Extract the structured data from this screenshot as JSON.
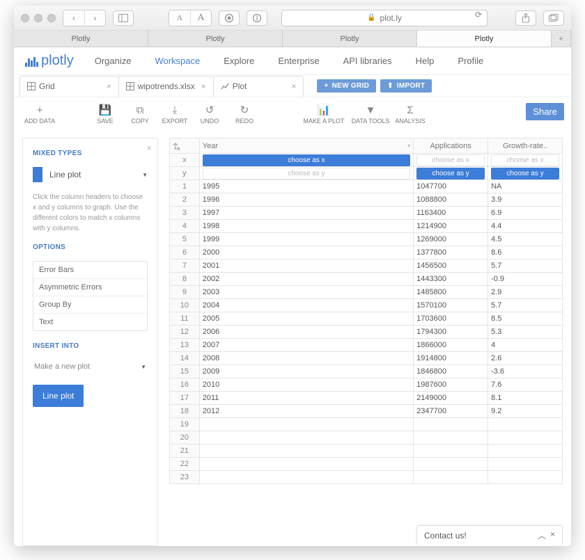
{
  "browser": {
    "url_host": "plot.ly",
    "tabs": [
      "Plotly",
      "Plotly",
      "Plotly",
      "Plotly"
    ],
    "active_tab_index": 3
  },
  "plotly_nav": {
    "brand": "plotly",
    "items": [
      "Organize",
      "Workspace",
      "Explore",
      "Enterprise",
      "API libraries",
      "Help",
      "Profile"
    ],
    "active_index": 1
  },
  "worksheet_tabs": {
    "grid_label": "Grid",
    "file_label": "wipotrends.xlsx",
    "plot_label": "Plot",
    "new_grid_btn": "NEW GRID",
    "import_btn": "IMPORT"
  },
  "toolbar": {
    "add_data": "ADD DATA",
    "save": "SAVE",
    "copy": "COPY",
    "export": "EXPORT",
    "undo": "UNDO",
    "redo": "REDO",
    "make_plot": "MAKE A PLOT",
    "data_tools": "DATA TOOLS",
    "analysis": "ANALYSIS",
    "share": "Share"
  },
  "left_panel": {
    "title": "MIXED TYPES",
    "chip_label": "Line plot",
    "help": "Click the column headers to choose x and y columns to graph. Use the different colors to match x columns with y columns.",
    "options_title": "OPTIONS",
    "options": [
      "Error Bars",
      "Asymmetric Errors",
      "Group By",
      "Text"
    ],
    "insert_title": "INSERT INTO",
    "insert_value": "Make a new plot",
    "primary_btn": "Line plot"
  },
  "grid": {
    "axis_labels": {
      "x": "x",
      "y": "y"
    },
    "columns": [
      "Year",
      "Applications",
      "Growth-rate.."
    ],
    "choose_x": "choose as x",
    "choose_y": "choose as y",
    "rows": [
      {
        "n": 1,
        "Year": "1995",
        "Applications": "1047700",
        "Growth": "NA"
      },
      {
        "n": 2,
        "Year": "1996",
        "Applications": "1088800",
        "Growth": "3.9"
      },
      {
        "n": 3,
        "Year": "1997",
        "Applications": "1163400",
        "Growth": "6.9"
      },
      {
        "n": 4,
        "Year": "1998",
        "Applications": "1214900",
        "Growth": "4.4"
      },
      {
        "n": 5,
        "Year": "1999",
        "Applications": "1269000",
        "Growth": "4.5"
      },
      {
        "n": 6,
        "Year": "2000",
        "Applications": "1377800",
        "Growth": "8.6"
      },
      {
        "n": 7,
        "Year": "2001",
        "Applications": "1456500",
        "Growth": "5.7"
      },
      {
        "n": 8,
        "Year": "2002",
        "Applications": "1443300",
        "Growth": "-0.9"
      },
      {
        "n": 9,
        "Year": "2003",
        "Applications": "1485800",
        "Growth": "2.9"
      },
      {
        "n": 10,
        "Year": "2004",
        "Applications": "1570100",
        "Growth": "5.7"
      },
      {
        "n": 11,
        "Year": "2005",
        "Applications": "1703600",
        "Growth": "8.5"
      },
      {
        "n": 12,
        "Year": "2006",
        "Applications": "1794300",
        "Growth": "5.3"
      },
      {
        "n": 13,
        "Year": "2007",
        "Applications": "1866000",
        "Growth": "4"
      },
      {
        "n": 14,
        "Year": "2008",
        "Applications": "1914800",
        "Growth": "2.6"
      },
      {
        "n": 15,
        "Year": "2009",
        "Applications": "1846800",
        "Growth": "-3.6"
      },
      {
        "n": 16,
        "Year": "2010",
        "Applications": "1987600",
        "Growth": "7.6"
      },
      {
        "n": 17,
        "Year": "2011",
        "Applications": "2149000",
        "Growth": "8.1"
      },
      {
        "n": 18,
        "Year": "2012",
        "Applications": "2347700",
        "Growth": "9.2"
      }
    ],
    "empty_rows": [
      19,
      20,
      21,
      22,
      23
    ]
  },
  "contact": {
    "label": "Contact us!"
  }
}
